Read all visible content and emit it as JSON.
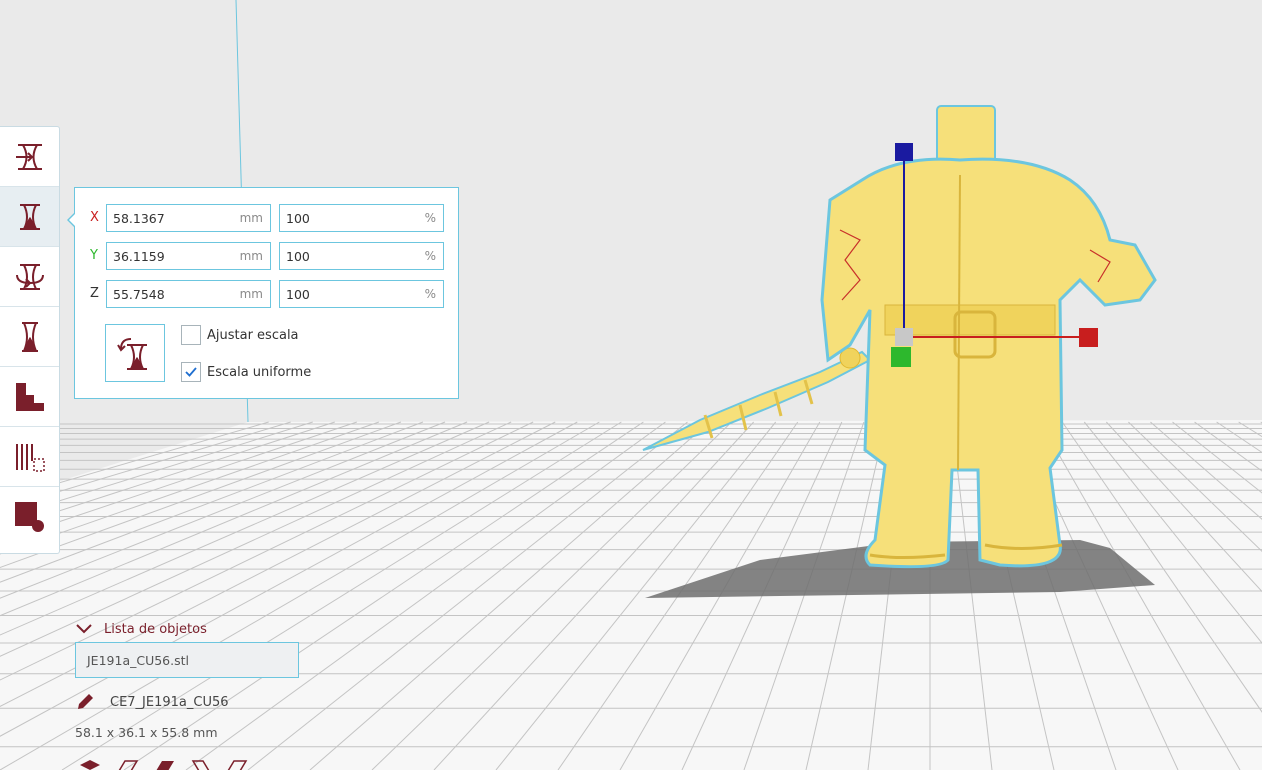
{
  "colors": {
    "accent": "#7a1f2b",
    "highlight": "#6cc6df",
    "axis_x": "#c81e1e",
    "axis_y": "#2db82d",
    "axis_z": "#1a1aa0",
    "model": "#f6e07a"
  },
  "toolbar": {
    "tools": [
      {
        "name": "move-tool-icon"
      },
      {
        "name": "scale-tool-icon",
        "active": true
      },
      {
        "name": "rotate-tool-icon"
      },
      {
        "name": "mirror-tool-icon"
      },
      {
        "name": "per-model-settings-icon"
      },
      {
        "name": "support-blocker-icon"
      },
      {
        "name": "custom-support-icon"
      }
    ]
  },
  "scale_panel": {
    "x": {
      "axis": "X",
      "mm": "58.1367",
      "mm_unit": "mm",
      "percent": "100",
      "percent_unit": "%"
    },
    "y": {
      "axis": "Y",
      "mm": "36.1159",
      "mm_unit": "mm",
      "percent": "100",
      "percent_unit": "%"
    },
    "z": {
      "axis": "Z",
      "mm": "55.7548",
      "mm_unit": "mm",
      "percent": "100",
      "percent_unit": "%"
    },
    "snap_scaling": {
      "label": "Ajustar escala",
      "checked": false
    },
    "uniform_scaling": {
      "label": "Escala uniforme",
      "checked": true
    }
  },
  "object_list": {
    "header": "Lista de objetos",
    "items": [
      "JE191a_CU56.stl"
    ],
    "job_name": "CE7_JE191a_CU56",
    "dimensions": "58.1 x 36.1 x 55.8 mm"
  }
}
